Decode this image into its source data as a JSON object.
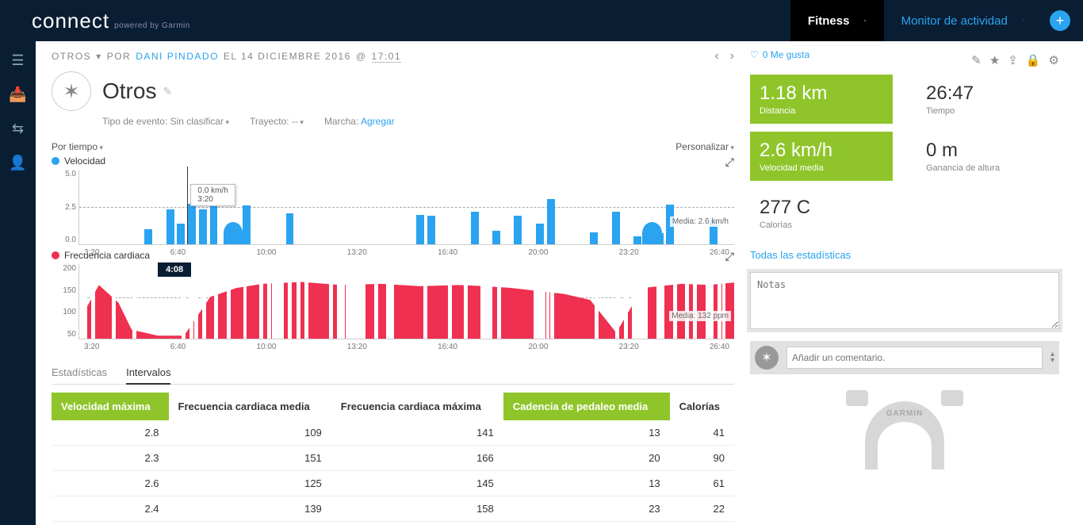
{
  "header": {
    "brand": "connect",
    "brand_sub": "powered by Garmin",
    "tabs": {
      "fitness": "Fitness",
      "activity_monitor": "Monitor de actividad"
    },
    "add_icon": "+"
  },
  "breadcrumb": {
    "category": "OTROS",
    "by": "POR",
    "user": "DANI PINDADO",
    "on": "EL 14 DICIEMBRE 2016",
    "at": "@",
    "time": "17:01"
  },
  "title": {
    "text": "Otros",
    "meta": {
      "event_type_label": "Tipo de evento: Sin clasificar",
      "course_label": "Trayecto: --",
      "gear_label": "Marcha:",
      "gear_link": "Agregar"
    }
  },
  "panel": {
    "left_dd": "Por tiempo",
    "right_dd": "Personalizar"
  },
  "chart_data": [
    {
      "type": "line",
      "name": "Velocidad",
      "ylabel": "km/h",
      "ylim": [
        0.0,
        5.0
      ],
      "yticks": [
        0.0,
        2.5,
        5.0
      ],
      "xticks": [
        "3:20",
        "6:40",
        "10:00",
        "13:20",
        "16:40",
        "20:00",
        "23:20",
        "26:40"
      ],
      "mean_label": "Media: 2.6 km/h",
      "tooltip_value": "0.0 km/h",
      "tooltip_x": "3:20",
      "tooltip_time": "4:08"
    },
    {
      "type": "line",
      "name": "Frecuencia cardiaca",
      "ylabel": "ppm",
      "ylim": [
        50,
        200
      ],
      "yticks": [
        50,
        100,
        150,
        200
      ],
      "xticks": [
        "3:20",
        "6:40",
        "10:00",
        "13:20",
        "16:40",
        "20:00",
        "23:20",
        "26:40"
      ],
      "mean_label": "Media: 132 ppm"
    }
  ],
  "stats_right": {
    "like_label": "0 Me gusta",
    "distance": {
      "value": "1.18 km",
      "label": "Distancia"
    },
    "time": {
      "value": "26:47",
      "label": "Tiempo"
    },
    "avg_speed": {
      "value": "2.6 km/h",
      "label": "Velocidad media"
    },
    "elev_gain": {
      "value": "0 m",
      "label": "Ganancia de altura"
    },
    "calories": {
      "value": "277 C",
      "label": "Calorías"
    },
    "all_stats": "Todas las estadísticas",
    "notes_placeholder": "Notas",
    "comment_placeholder": "Añadir un comentario.",
    "device_brand": "GARMIN"
  },
  "sub_tabs": {
    "stats": "Estadísticas",
    "intervals": "Intervalos"
  },
  "table": {
    "headers": [
      "Velocidad máxima",
      "Frecuencia cardiaca media",
      "Frecuencia cardiaca máxima",
      "Cadencia de pedaleo media",
      "Calorías"
    ],
    "highlight": [
      0,
      3
    ],
    "rows": [
      [
        "2.8",
        "109",
        "141",
        "13",
        "41"
      ],
      [
        "2.3",
        "151",
        "166",
        "20",
        "90"
      ],
      [
        "2.6",
        "125",
        "145",
        "13",
        "61"
      ],
      [
        "2.4",
        "139",
        "158",
        "23",
        "22"
      ]
    ]
  }
}
